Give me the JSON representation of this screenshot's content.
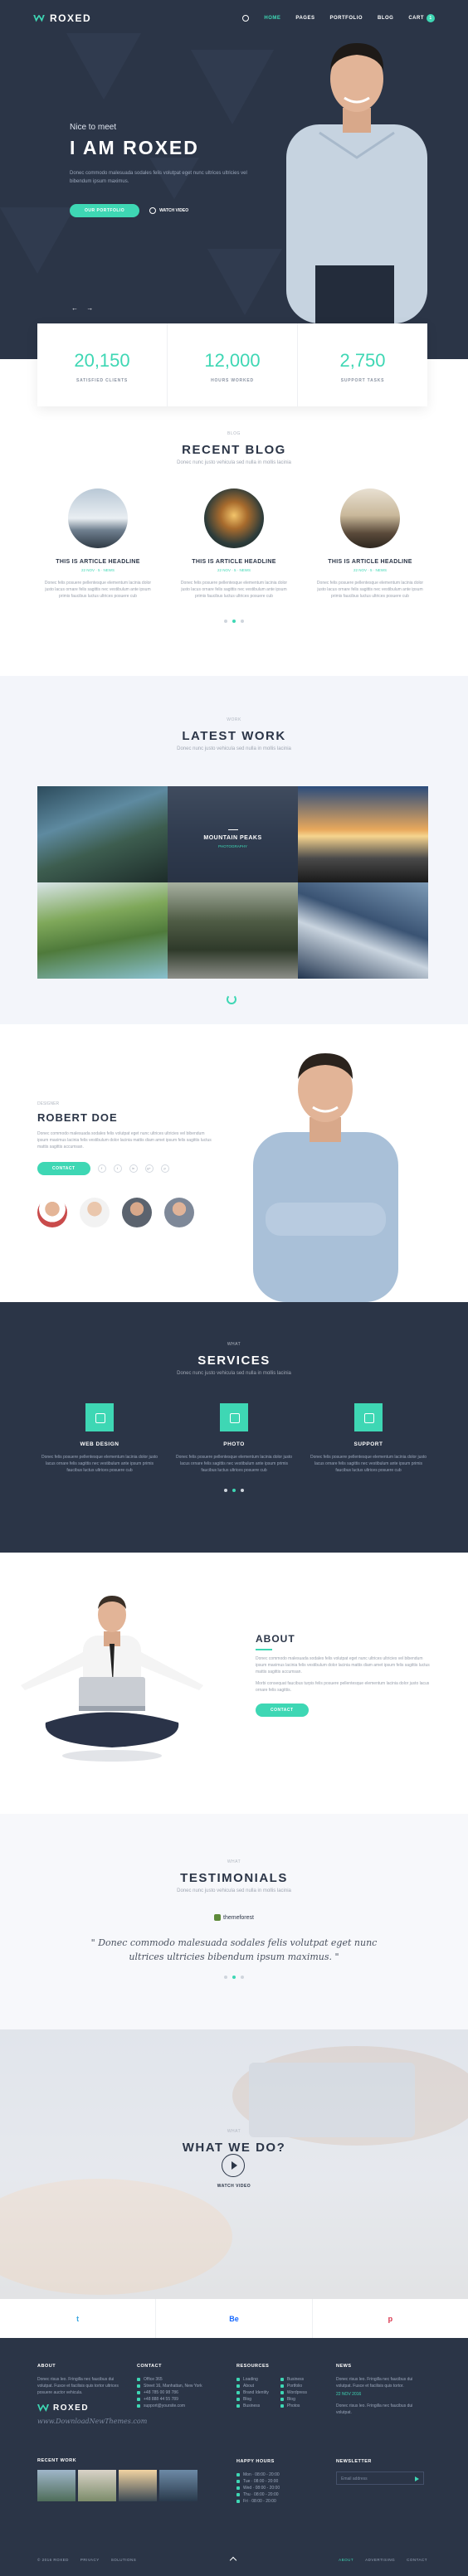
{
  "nav": {
    "brand": "ROXED",
    "links": [
      "HOME",
      "PAGES",
      "PORTFOLIO",
      "BLOG"
    ],
    "cart_label": "CART",
    "cart_count": "1"
  },
  "hero": {
    "greeting": "Nice to meet",
    "title": "I AM ROXED",
    "text": "Donec commodo malesuada sodales felis volutpat eget nunc ultrices ultricies vel bibendum ipsum maximus.",
    "primary_btn": "OUR PORTFOLIO",
    "secondary_btn": "WATCH VIDEO",
    "arrows": "←  →"
  },
  "stats": [
    {
      "num": "20,150",
      "label": "SATISFIED CLIENTS"
    },
    {
      "num": "12,000",
      "label": "HOURS WORKED"
    },
    {
      "num": "2,750",
      "label": "SUPPORT TASKS"
    }
  ],
  "blog": {
    "kicker": "BLOG",
    "title": "RECENT BLOG",
    "subtitle": "Donec nunc justo vehicula sed nulla in mollis lacinia",
    "posts": [
      {
        "title": "THIS IS ARTICLE HEADLINE",
        "meta": "22 NOV  ·  5   ·  NEWS",
        "text": "Donec felis posuere pellentesque elementum lacinia dolor justo lacus ornare felis sagittis nec vestibulum ante ipsum primis faucibus luctus ultrices posuere cub"
      },
      {
        "title": "THIS IS ARTICLE HEADLINE",
        "meta": "22 NOV  ·  5   ·  NEWS",
        "text": "Donec felis posuere pellentesque elementum lacinia dolor justo lacus ornare felis sagittis nec vestibulum ante ipsum primis faucibus luctus ultrices posuere cub"
      },
      {
        "title": "THIS IS ARTICLE HEADLINE",
        "meta": "22 NOV  ·  5   ·  NEWS",
        "text": "Donec felis posuere pellentesque elementum lacinia dolor justo lacus ornare felis sagittis nec vestibulum ante ipsum primis faucibus luctus ultrices posuere cub"
      }
    ]
  },
  "work": {
    "kicker": "WORK",
    "title": "LATEST WORK",
    "subtitle": "Donec nunc justo vehicula sed nulla in mollis lacinia",
    "overlay_title": "MOUNTAIN PEAKS",
    "overlay_cat": "PHOTOGRAPHY"
  },
  "bio": {
    "kicker": "DESIGNER",
    "name": "ROBERT DOE",
    "text": "Donec commodo malesuada sodales felis volutpat eget nunc ultrices ultricies vel bibendum ipsum maximus lacinia felis vestibulum dolor lacinia mattis diam amet ipsum felis sagittis luctus mattis sagittis accumsan.",
    "btn": "CONTACT",
    "socials": [
      "f",
      "t",
      "in",
      "g+",
      "p"
    ]
  },
  "services": {
    "kicker": "WHAT",
    "title": "SERVICES",
    "subtitle": "Donec nunc justo vehicula sed nulla in mollis lacinia",
    "items": [
      {
        "title": "WEB DESIGN",
        "text": "Donec felis posuere pellentesque elementum lacinia dolor justo lacus ornare felis sagittis nec vestibulum ante ipsum primis faucibus luctus ultrices posuere cub"
      },
      {
        "title": "PHOTO",
        "text": "Donec felis posuere pellentesque elementum lacinia dolor justo lacus ornare felis sagittis nec vestibulum ante ipsum primis faucibus luctus ultrices posuere cub"
      },
      {
        "title": "SUPPORT",
        "text": "Donec felis posuere pellentesque elementum lacinia dolor justo lacus ornare felis sagittis nec vestibulum ante ipsum primis faucibus luctus ultrices posuere cub"
      }
    ]
  },
  "about": {
    "title": "ABOUT",
    "text1": "Donec commodo malesuada sodales felis volutpat eget nunc ultrices ultricies vel bibendum ipsum maximus lacinia felis vestibulum dolor lacinia mattis diam amet ipsum felis sagittis luctus mattis sagittis accumsan.",
    "text2": "Morbi consequat faucibus turpis felis posuere pellentesque elementum lacinia dolor justo lacus ornare felis sagittis.",
    "btn": "CONTACT"
  },
  "testimonials": {
    "kicker": "WHAT",
    "title": "TESTIMONIALS",
    "subtitle": "Donec nunc justo vehicula sed nulla in mollis lacinia",
    "brand": "themeforest",
    "quote": "\" Donec commodo malesuada sodales felis volutpat eget nunc ultrices ultricies bibendum ipsum maximus. \""
  },
  "whatwedo": {
    "kicker": "WHAT",
    "title": "WHAT WE DO?",
    "video_label": "WATCH VIDEO"
  },
  "socialbar": [
    "t",
    "Be",
    "p"
  ],
  "footer": {
    "about_h": "ABOUT",
    "about_text": "Donec risus leo. Fringilla nec faucibus dui volutpat. Fusce et facilisis quis tortor ultrices posuere auctor vehicula.",
    "brand": "ROXED",
    "watermark": "www.DownloadNewThemes.com",
    "contact_h": "CONTACT",
    "contact": [
      "Office 365",
      "Street 16, Manhattan, New York",
      "+48 785 00 98 786",
      "+48 888 44 55 789",
      "support@yoursite.com"
    ],
    "resources_h": "RESOURCES",
    "resources_a": [
      "Loading",
      "About",
      "Brand Identity",
      "Blog",
      "Business"
    ],
    "resources_b": [
      "Business",
      "Portfolio",
      "Wordpress",
      "Blog",
      "Photos"
    ],
    "news_h": "NEWS",
    "news_text": "Donec risus leo. Fringilla nec faucibus dui volutpat. Fusce et facilisis quis tortor.",
    "news_date": "22 NOV 2016",
    "news_text2": "Donec risus leo. Fringilla nec faucibus dui volutpat.",
    "recent_h": "RECENT WORK",
    "hours_h": "HAPPY HOURS",
    "hours": [
      "Mon  ·  08:00 - 20:00",
      "Tue  ·  08:00 - 20:00",
      "Wed  ·  08:00 - 20:00",
      "Thu  ·  08:00 - 20:00",
      "Fri  ·  08:00 - 20:00"
    ],
    "newsletter_h": "NEWSLETTER",
    "newsletter_placeholder": "Email address",
    "copyright": "© 2016 ROXED",
    "privacy": "PRIVACY",
    "solutions": "SOLUTIONS",
    "bottom_links": [
      "ABOUT",
      "ADVERTISING",
      "CONTACT"
    ]
  }
}
